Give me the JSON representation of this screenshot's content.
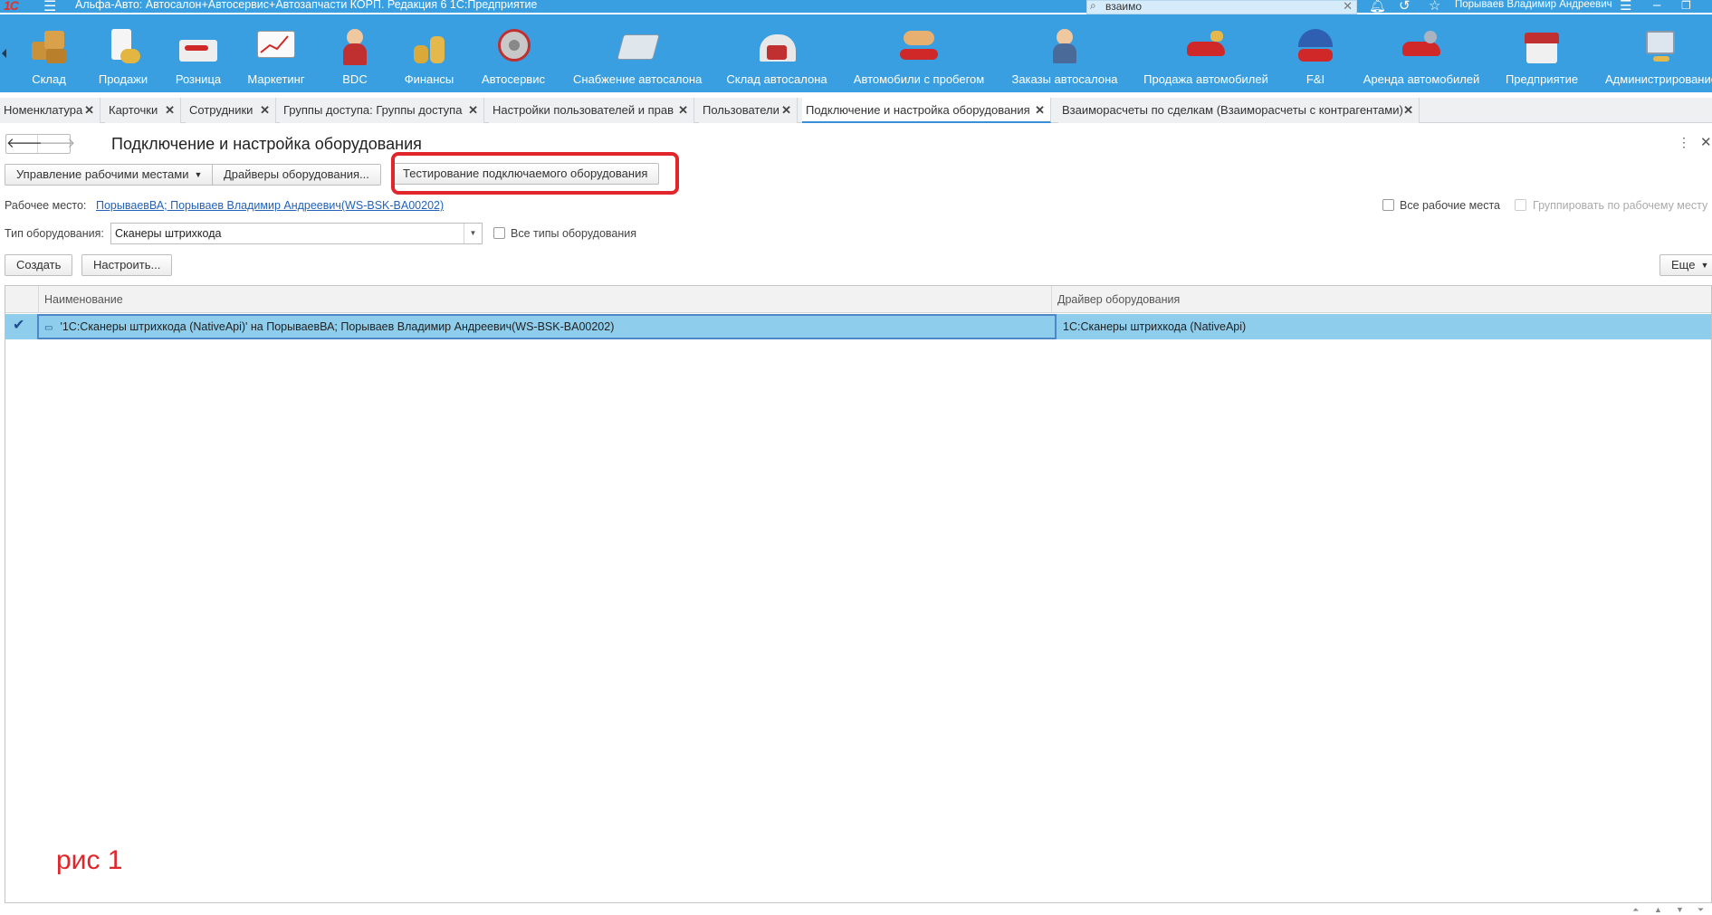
{
  "titlebar": {
    "logo": "1С",
    "title": "Альфа-Авто: Автосалон+Автосервис+Автозапчасти КОРП. Редакция 6 1С:Предприятие",
    "search_value": "взаимо",
    "user": "Порываев Владимир Андреевич"
  },
  "sections": [
    {
      "label": "Склад",
      "icon": "warehouse-icon"
    },
    {
      "label": "Продажи",
      "icon": "sales-icon"
    },
    {
      "label": "Розница",
      "icon": "cash-register-icon"
    },
    {
      "label": "Маркетинг",
      "icon": "marketing-chart-icon"
    },
    {
      "label": "BDC",
      "icon": "operator-icon"
    },
    {
      "label": "Финансы",
      "icon": "coins-icon"
    },
    {
      "label": "Автосервис",
      "icon": "brake-disc-icon"
    },
    {
      "label": "Снабжение автосалона",
      "icon": "calculator-icon"
    },
    {
      "label": "Склад автосалона",
      "icon": "garage-icon"
    },
    {
      "label": "Автомобили с пробегом",
      "icon": "handshake-car-icon"
    },
    {
      "label": "Заказы автосалона",
      "icon": "client-icon"
    },
    {
      "label": "Продажа автомобилей",
      "icon": "car-coins-icon"
    },
    {
      "label": "F&I",
      "icon": "insurance-umbrella-icon"
    },
    {
      "label": "Аренда автомобилей",
      "icon": "rental-car-icon"
    },
    {
      "label": "Предприятие",
      "icon": "building-icon"
    },
    {
      "label": "Администрирование",
      "icon": "computer-icon"
    }
  ],
  "tabs": [
    {
      "label": "Номенклатура"
    },
    {
      "label": "Карточки"
    },
    {
      "label": "Сотрудники"
    },
    {
      "label": "Группы доступа: Группы доступа"
    },
    {
      "label": "Настройки пользователей и прав"
    },
    {
      "label": "Пользователи"
    },
    {
      "label": "Подключение и настройка оборудования",
      "active": true
    },
    {
      "label": "Взаиморасчеты по сделкам (Взаиморасчеты с контрагентами)"
    }
  ],
  "form": {
    "title": "Подключение и настройка оборудования",
    "buttons": {
      "workplaces": "Управление рабочими местами",
      "drivers": "Драйверы оборудования...",
      "testing": "Тестирование подключаемого оборудования",
      "create": "Создать",
      "configure": "Настроить...",
      "more": "Еще"
    },
    "workplace_label": "Рабочее место:",
    "workplace_value": "ПорываевВА; Порываев Владимир Андреевич(WS-BSK-BA00202)",
    "all_workplaces": "Все рабочие места",
    "group_by_workplace": "Группировать по рабочему месту",
    "equipment_type_label": "Тип оборудования:",
    "equipment_type_value": "Сканеры штрихкода",
    "all_equipment_types": "Все типы оборудования"
  },
  "table": {
    "columns": [
      "Наименование",
      "Драйвер оборудования"
    ],
    "rows": [
      {
        "name": "'1С:Сканеры штрихкода (NativeApi)' на ПорываевВА; Порываев Владимир Андреевич(WS-BSK-BA00202)",
        "driver": "1С:Сканеры штрихкода (NativeApi)",
        "selected": true
      }
    ]
  },
  "caption": "рис 1",
  "colors": {
    "header_blue": "#3a9fe0",
    "highlight_red": "#e0262b",
    "row_selected": "#8fcdec",
    "link": "#2362b8"
  }
}
